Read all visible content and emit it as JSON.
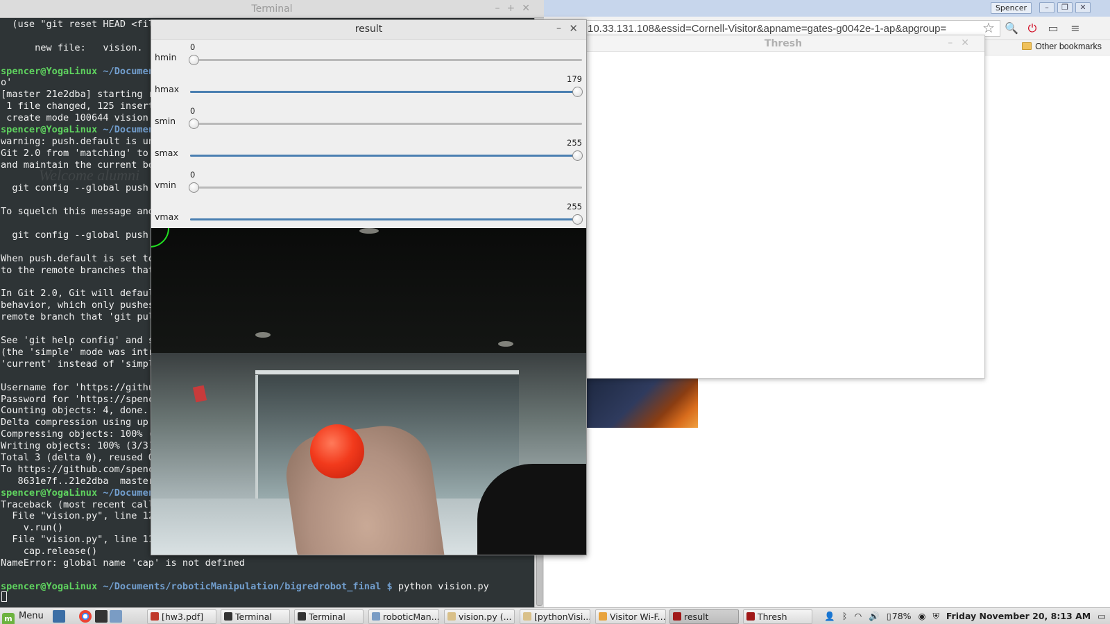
{
  "terminal": {
    "title": "Terminal",
    "lines": [
      "  (use \"git reset HEAD <file",
      "",
      "      new file:   vision.",
      "",
      "",
      "o'",
      "[master 21e2dba] starting re",
      " 1 file changed, 125 inserti",
      " create mode 100644 vision.p",
      "",
      "warning: push.default is uns",
      "Git 2.0 from 'matching' to ",
      "and maintain the current beh",
      "",
      "  git config --global push.d",
      "",
      "To squelch this message and ",
      "",
      "  git config --global push.d",
      "",
      "When push.default is set to ",
      "to the remote branches that ",
      "",
      "In Git 2.0, Git will default",
      "behavior, which only pushes ",
      "remote branch that 'git pull",
      "",
      "See 'git help config' and se",
      "(the 'simple' mode was intro",
      "'current' instead of 'simple",
      "",
      "Username for 'https://github",
      "Password for 'https://spence",
      "Counting objects: 4, done.",
      "Delta compression using up t",
      "Compressing objects: 100% (3",
      "Writing objects: 100% (3/3),",
      "Total 3 (delta 0), reused 0 ",
      "To https://github.com/spence",
      "   8631e7f..21e2dba  master ",
      "",
      "Traceback (most recent call ",
      "  File \"vision.py\", line 125",
      "    v.run()",
      "  File \"vision.py\", line 119",
      "    cap.release()",
      "NameError: global name 'cap' is not defined",
      ""
    ],
    "prompts": {
      "user": "spencer@YogaLinux",
      "path_short": "~/Documen",
      "path_full": "~/Documents/roboticManipulation/bigredrobot_final",
      "symbol": "$",
      "last_command": "python vision.py"
    }
  },
  "chrome": {
    "user_badge": "Spencer",
    "url": "10.33.131.108&essid=Cornell-Visitor&apname=gates-g0042e-1-ap&apgroup=",
    "bookmarks_other": "Other bookmarks",
    "window_buttons": [
      "–",
      "❐",
      "✕"
    ]
  },
  "thresh": {
    "title": "Thresh"
  },
  "result": {
    "title": "result",
    "trackbars": [
      {
        "name": "hmin",
        "value": 0,
        "max": 179
      },
      {
        "name": "hmax",
        "value": 179,
        "max": 179
      },
      {
        "name": "smin",
        "value": 0,
        "max": 255
      },
      {
        "name": "smax",
        "value": 255,
        "max": 255
      },
      {
        "name": "vmin",
        "value": 0,
        "max": 255
      },
      {
        "name": "vmax",
        "value": 255,
        "max": 255
      }
    ]
  },
  "taskbar": {
    "menu_label": "Menu",
    "tasks": [
      {
        "label": "[hw3.pdf]",
        "color": "#c0392b"
      },
      {
        "label": "Terminal",
        "color": "#333333"
      },
      {
        "label": "Terminal",
        "color": "#333333"
      },
      {
        "label": "roboticMan...",
        "color": "#7a9cc4"
      },
      {
        "label": "vision.py (...",
        "color": "#d9c089"
      },
      {
        "label": "[pythonVisi...",
        "color": "#d9c089"
      },
      {
        "label": "Visitor Wi-F...",
        "color": "#e8a33d"
      },
      {
        "label": "result",
        "color": "#a01818"
      },
      {
        "label": "Thresh",
        "color": "#a01818"
      }
    ],
    "battery": "78%",
    "clock": "Friday November 20,  8:13 AM"
  }
}
